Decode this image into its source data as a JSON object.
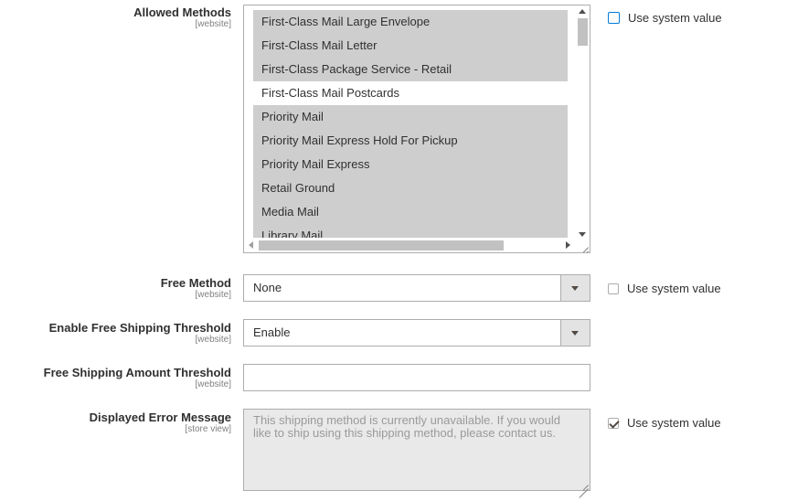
{
  "allowed_methods": {
    "label": "Allowed Methods",
    "scope": "[website]",
    "use_system_label": "Use system value",
    "use_system_checked": false,
    "options": [
      {
        "label": "First-Class Mail Large Envelope",
        "selected": true
      },
      {
        "label": "First-Class Mail Letter",
        "selected": true
      },
      {
        "label": "First-Class Package Service - Retail",
        "selected": true
      },
      {
        "label": "First-Class Mail Postcards",
        "selected": false
      },
      {
        "label": "Priority Mail",
        "selected": true
      },
      {
        "label": "Priority Mail Express Hold For Pickup",
        "selected": true
      },
      {
        "label": "Priority Mail Express",
        "selected": true
      },
      {
        "label": "Retail Ground",
        "selected": true
      },
      {
        "label": "Media Mail",
        "selected": true
      },
      {
        "label": "Library Mail",
        "selected": true
      }
    ]
  },
  "free_method": {
    "label": "Free Method",
    "scope": "[website]",
    "value": "None",
    "use_system_label": "Use system value",
    "use_system_checked": false
  },
  "free_shipping_threshold": {
    "label": "Enable Free Shipping Threshold",
    "scope": "[website]",
    "value": "Enable"
  },
  "free_shipping_amount": {
    "label": "Free Shipping Amount Threshold",
    "scope": "[website]",
    "value": ""
  },
  "error_message": {
    "label": "Displayed Error Message",
    "scope": "[store view]",
    "value": "This shipping method is currently unavailable. If you would like to ship using this shipping method, please contact us.",
    "use_system_label": "Use system value",
    "use_system_checked": true
  }
}
